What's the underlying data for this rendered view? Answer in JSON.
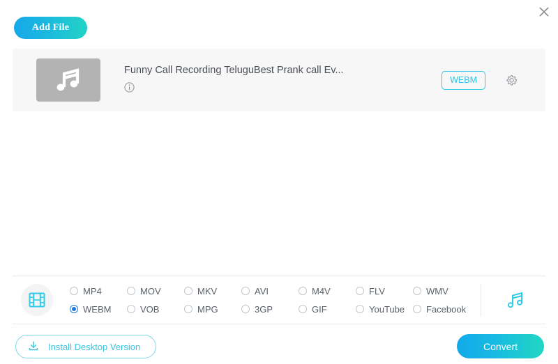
{
  "window": {
    "close_label": "✕"
  },
  "toolbar": {
    "add_file_label": "Add File"
  },
  "file_list": {
    "items": [
      {
        "title": "Funny Call Recording TeluguBest Prank call Ev...",
        "format_badge": "WEBM",
        "thumb_icon": "music-note-icon",
        "info_icon": "info-icon",
        "settings_icon": "gear-icon"
      }
    ]
  },
  "format_panel": {
    "video_icon": "film-strip-icon",
    "audio_icon": "music-note-icon",
    "selected": "WEBM",
    "options": [
      "MP4",
      "MOV",
      "MKV",
      "AVI",
      "M4V",
      "FLV",
      "WMV",
      "WEBM",
      "VOB",
      "MPG",
      "3GP",
      "GIF",
      "YouTube",
      "Facebook"
    ]
  },
  "footer": {
    "install_label": "Install Desktop Version",
    "install_icon": "download-icon",
    "convert_label": "Convert"
  },
  "colors": {
    "accent_cyan": "#2ec8e6",
    "accent_blue": "#1f7ae0",
    "gradient_start": "#13a9ea",
    "gradient_end": "#22d6c2",
    "panel_bg": "#f7f7f7",
    "text": "#555c63"
  }
}
